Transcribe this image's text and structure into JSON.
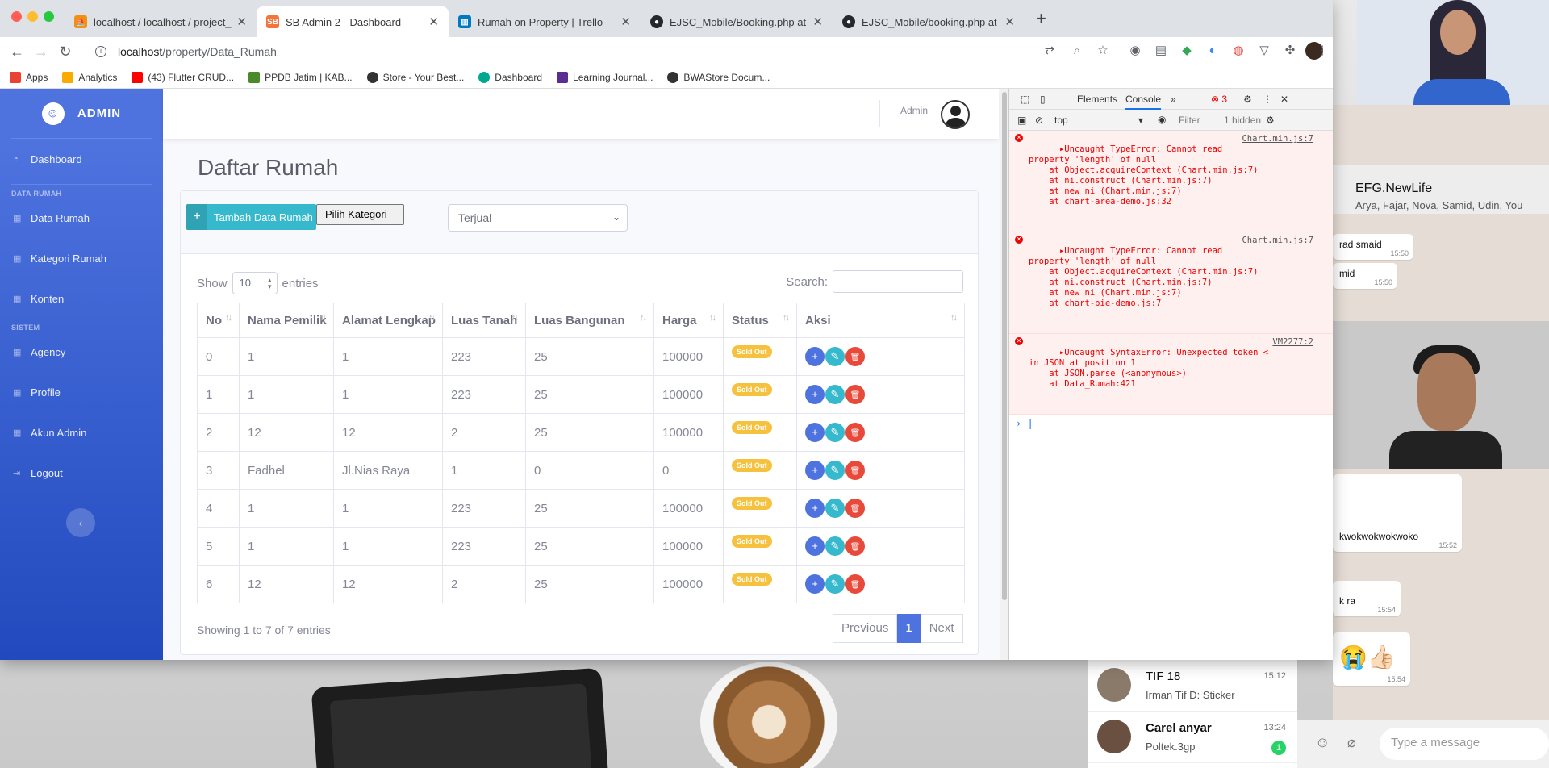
{
  "browser": {
    "tabs": [
      {
        "title": "localhost / localhost / project_p",
        "favicon_color": "#f29111"
      },
      {
        "title": "SB Admin 2 - Dashboard",
        "favicon_color": "#f4743b"
      },
      {
        "title": "Rumah on Property | Trello",
        "favicon_color": "#0079bf"
      },
      {
        "title": "EJSC_Mobile/Booking.php at m",
        "favicon_color": "#24292e"
      },
      {
        "title": "EJSC_Mobile/booking.php at m",
        "favicon_color": "#24292e"
      }
    ],
    "url_host": "localhost",
    "url_path": "/property/Data_Rumah",
    "bookmarks": [
      {
        "label": "Apps",
        "color": "#ea4335"
      },
      {
        "label": "Analytics",
        "color": "#f9ab00"
      },
      {
        "label": "(43) Flutter CRUD...",
        "color": "#ff0000"
      },
      {
        "label": "PPDB Jatim | KAB...",
        "color": "#4a8a2a"
      },
      {
        "label": "Store - Your Best...",
        "color": "#333333"
      },
      {
        "label": "Dashboard",
        "color": "#00a88f"
      },
      {
        "label": "Learning Journal...",
        "color": "#5c2d91"
      },
      {
        "label": "BWAStore Docum...",
        "color": "#333333"
      }
    ]
  },
  "sidebar": {
    "brand": "ADMIN",
    "dashboard": "Dashboard",
    "heading_data": "DATA RUMAH",
    "data_rumah": "Data Rumah",
    "kategori": "Kategori Rumah",
    "konten": "Konten",
    "heading_sistem": "SISTEM",
    "agency": "Agency",
    "profile": "Profile",
    "akun_admin": "Akun Admin",
    "logout": "Logout"
  },
  "topbar": {
    "user": "Admin"
  },
  "page": {
    "title": "Daftar Rumah",
    "add_button": "Tambah Data Rumah",
    "category_button": "Pilih Kategori",
    "status_select": "Terjual",
    "show": "Show",
    "entries_value": "10",
    "entries": "entries",
    "search_label": "Search:",
    "info": "Showing 1 to 7 of 7 entries",
    "pager": {
      "prev": "Previous",
      "current": "1",
      "next": "Next"
    }
  },
  "table": {
    "headers": [
      "No",
      "Nama Pemilik",
      "Alamat Lengkap",
      "Luas Tanah",
      "Luas Bangunan",
      "Harga",
      "Status",
      "Aksi"
    ],
    "rows": [
      [
        "0",
        "1",
        "1",
        "223",
        "25",
        "100000",
        "Sold Out"
      ],
      [
        "1",
        "1",
        "1",
        "223",
        "25",
        "100000",
        "Sold Out"
      ],
      [
        "2",
        "12",
        "12",
        "2",
        "25",
        "100000",
        "Sold Out"
      ],
      [
        "3",
        "Fadhel",
        "Jl.Nias Raya",
        "1",
        "0",
        "0",
        "Sold Out"
      ],
      [
        "4",
        "1",
        "1",
        "223",
        "25",
        "100000",
        "Sold Out"
      ],
      [
        "5",
        "1",
        "1",
        "223",
        "25",
        "100000",
        "Sold Out"
      ],
      [
        "6",
        "12",
        "12",
        "2",
        "25",
        "100000",
        "Sold Out"
      ]
    ]
  },
  "devtools": {
    "tab_elements": "Elements",
    "tab_console": "Console",
    "error_count": "3",
    "context": "top",
    "filter": "Filter",
    "hidden": "1 hidden",
    "errors": [
      {
        "text": "Uncaught TypeError: Cannot read\nproperty 'length' of null\n    at Object.acquireContext (Chart.min.js:7)\n    at ni.construct (Chart.min.js:7)\n    at new ni (Chart.min.js:7)\n    at chart-area-demo.js:32",
        "src": "Chart.min.js:7"
      },
      {
        "text": "Uncaught TypeError: Cannot read\nproperty 'length' of null\n    at Object.acquireContext (Chart.min.js:7)\n    at ni.construct (Chart.min.js:7)\n    at new ni (Chart.min.js:7)\n    at chart-pie-demo.js:7",
        "src": "Chart.min.js:7"
      },
      {
        "text": "Uncaught SyntaxError: Unexpected token <\nin JSON at position 1\n    at JSON.parse (<anonymous>)\n    at Data_Rumah:421",
        "src": "VM2277:2"
      }
    ]
  },
  "whatsapp": {
    "group_name": "EFG.NewLife",
    "members": "Arya, Fajar, Nova, Samid, Udin, You",
    "msgs": [
      {
        "text": "rad smaid",
        "time": "15:50"
      },
      {
        "text": "mid",
        "time": "15:50"
      },
      {
        "text": "kwokwokwokwoko",
        "time": "15:52"
      },
      {
        "text": "k ra",
        "time": "15:54"
      },
      {
        "text": "😭👍🏻",
        "time": "15:54"
      }
    ],
    "chats": [
      {
        "name": "TIF 18",
        "msg": "Irman Tif D: Sticker",
        "time": "15:12"
      },
      {
        "name": "Carel anyar",
        "msg": "Poltek.3gp",
        "time": "13:24",
        "unread": "1"
      }
    ],
    "compose_placeholder": "Type a message"
  }
}
